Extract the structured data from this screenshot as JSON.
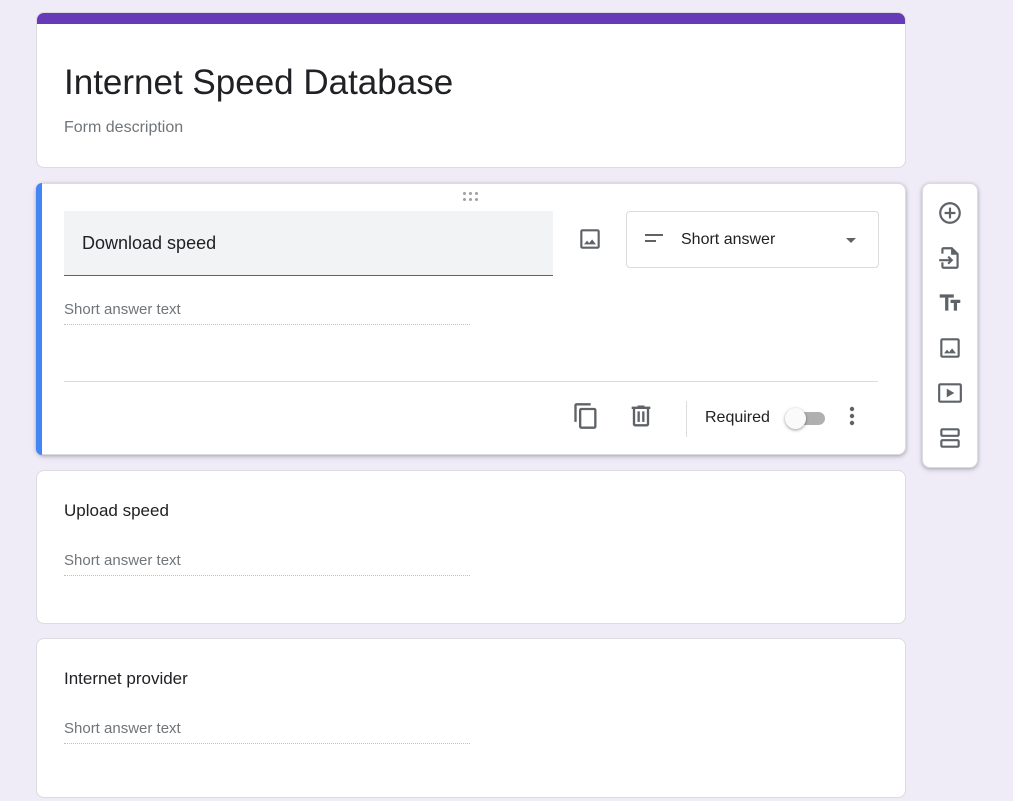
{
  "form": {
    "title": "Internet Speed Database",
    "description_placeholder": "Form description",
    "accent_color": "#673ab7",
    "active_question_color": "#4285f4"
  },
  "active_question": {
    "title": "Download speed",
    "type_selected": "Short answer",
    "answer_placeholder": "Short answer text",
    "required_label": "Required",
    "required": false
  },
  "questions": [
    {
      "title": "Upload speed",
      "answer_placeholder": "Short answer text"
    },
    {
      "title": "Internet provider",
      "answer_placeholder": "Short answer text"
    }
  ],
  "toolbar": {
    "buttons": [
      {
        "icon": "add-circle-icon"
      },
      {
        "icon": "import-questions-icon"
      },
      {
        "icon": "title-text-icon"
      },
      {
        "icon": "image-icon"
      },
      {
        "icon": "video-icon"
      },
      {
        "icon": "section-icon"
      }
    ]
  },
  "icons": {
    "question_image": "image-icon",
    "duplicate": "copy-icon",
    "delete": "trash-icon",
    "more": "more-vert-icon",
    "type": "short-text-icon",
    "dropdown": "chevron-down-icon"
  }
}
